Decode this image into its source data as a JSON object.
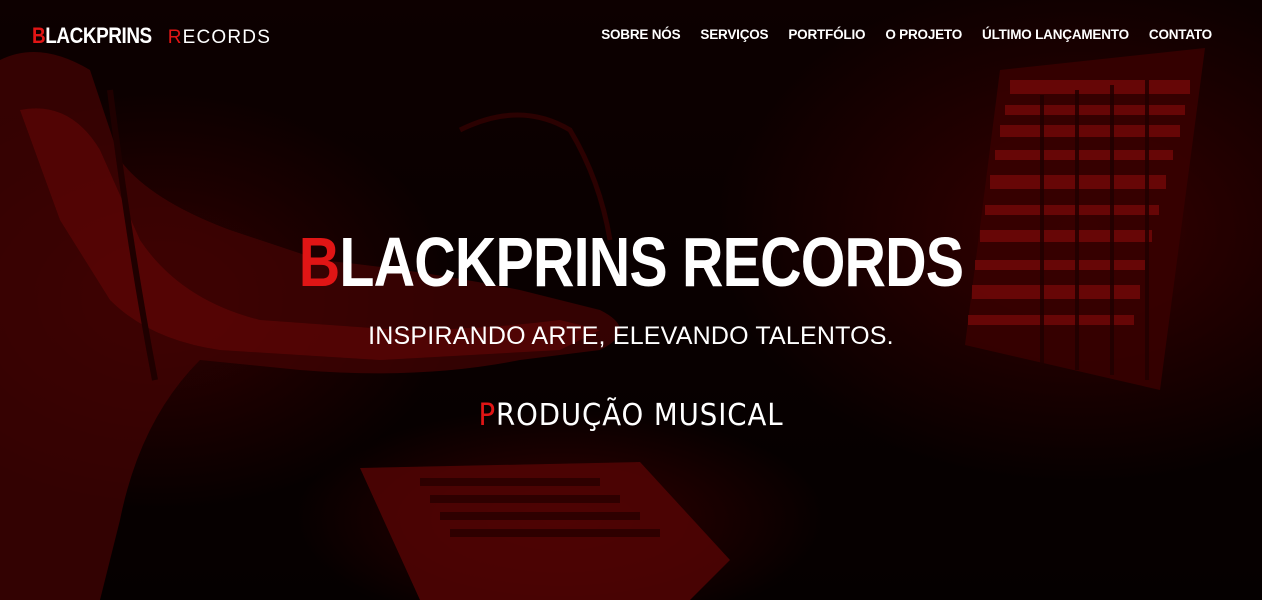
{
  "header": {
    "logo": {
      "first_letter": "B",
      "rest": "LACKPRINS",
      "second_first_letter": "R",
      "second_rest": "ECORDS"
    }
  },
  "nav": {
    "items": [
      {
        "label": "SOBRE NÓS"
      },
      {
        "label": "SERVIÇOS"
      },
      {
        "label": "PORTFÓLIO"
      },
      {
        "label": "O PROJETO"
      },
      {
        "label": "ÚLTIMO LANÇAMENTO"
      },
      {
        "label": "CONTATO"
      }
    ]
  },
  "hero": {
    "title_first_letter": "B",
    "title_rest": "LACKPRINS RECORDS",
    "subtitle": "INSPIRANDO ARTE, ELEVANDO TALENTOS.",
    "tagline_first_letter": "P",
    "tagline_rest": "RODUÇÃO MUSICAL"
  },
  "colors": {
    "accent": "#e01515",
    "text": "#ffffff",
    "background": "#0a0000"
  }
}
